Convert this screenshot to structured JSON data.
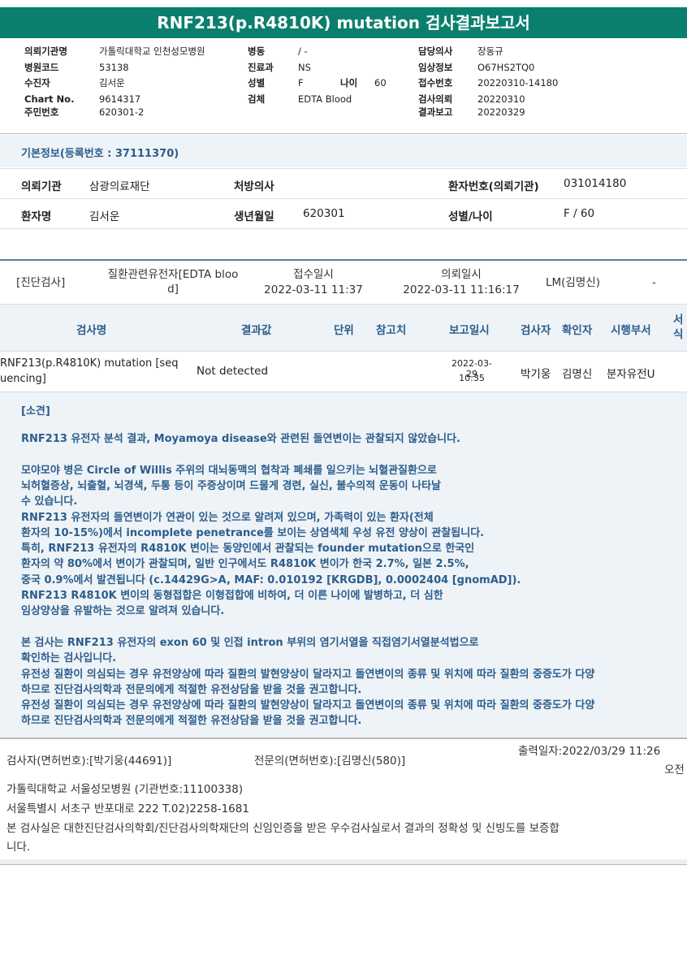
{
  "title": "RNF213(p.R4810K) mutation 검사결과보고서",
  "header": {
    "col1": [
      {
        "label": "의뢰기관명",
        "value": "가톨릭대학교 인천성모병원"
      },
      {
        "label": "병원코드",
        "value": "53138"
      },
      {
        "label": "수진자",
        "value": "김서운"
      },
      {
        "label": "Chart No.",
        "value": "9614317"
      },
      {
        "label": "주민번호",
        "value": "620301-2"
      }
    ],
    "col2": [
      {
        "label": "병동",
        "value": "/ -"
      },
      {
        "label": "진료과",
        "value": "NS"
      },
      {
        "label": "성별",
        "value": "F"
      },
      {
        "label": "검체",
        "value": "EDTA Blood"
      }
    ],
    "age_label": "나이",
    "age_value": "60",
    "col3": [
      {
        "label": "담당의사",
        "value": "장동규"
      },
      {
        "label": "임상정보",
        "value": "O67HS2TQ0"
      },
      {
        "label": "접수번호",
        "value": "20220310-14180"
      },
      {
        "label": "검사의뢰",
        "value": "20220310"
      },
      {
        "label": "결과보고",
        "value": "20220329"
      }
    ]
  },
  "basic": {
    "title": "기본정보(등록번호 : 37111370)",
    "req_org_label": "의뢰기관",
    "req_org": "삼광의료재단",
    "doctor_label": "처방의사",
    "patient_no_label": "환자번호(의뢰기관)",
    "patient_no": "031014180",
    "name_label": "환자명",
    "name": "김서운",
    "dob_label": "생년월일",
    "dob": "620301",
    "sex_age_label": "성별/나이",
    "sex_age": "F / 60"
  },
  "diag": {
    "type": "[진단검사]",
    "specimen_line1": "질환관련유전자[EDTA bloo",
    "specimen_line2": "d]",
    "received_label": "접수일시",
    "received": "2022-03-11 11:37",
    "requested_label": "의뢰일시",
    "requested": "2022-03-11 11:16:17",
    "lm": "LM(김명신)",
    "dash": "-"
  },
  "table": {
    "headers": [
      "검사명",
      "결과값",
      "단위",
      "참고치",
      "보고일시",
      "검사자",
      "확인자",
      "시행부서",
      "서식"
    ],
    "row": {
      "name_line1": "RNF213(p.R4810K) mutation [seq",
      "name_line2": "uencing]",
      "result": "Not detected",
      "date": "2022-03-29",
      "time": "10:35",
      "tester": "박기웅",
      "confirmer": "김명신",
      "dept": "분자유전U"
    }
  },
  "opinion": {
    "title": "[소견]",
    "lines": [
      "RNF213 유전자 분석 결과, Moyamoya disease와 관련된 돌연변이는 관찰되지 않았습니다.",
      "",
      "모야모야 병은 Circle of Willis 주위의 대뇌동맥의 협착과 폐쇄를 일으키는 뇌혈관질환으로",
      "뇌허혈증상, 뇌출혈, 뇌경색, 두통 등이 주증상이며 드물게 경련, 실신, 불수의적 운동이 나타날",
      "수 있습니다.",
      "RNF213 유전자의 돌연변이가 연관이 있는 것으로 알려져 있으며, 가족력이 있는 환자(전체",
      "환자의 10-15%)에서 incomplete penetrance를 보이는 상염색체 우성 유전 양상이 관찰됩니다.",
      "특히, RNF213 유전자의 R4810K 변이는 동양인에서 관찰되는 founder mutation으로 한국인",
      "환자의 약 80%에서 변이가 관찰되며, 일반 인구에서도 R4810K 변이가 한국 2.7%, 일본 2.5%,",
      "중국 0.9%에서 발견됩니다 (c.14429G>A, MAF: 0.010192 [KRGDB], 0.0002404 [gnomAD]).",
      "RNF213 R4810K 변이의 동형접합은 이형접합에 비하여, 더 이른 나이에 발병하고, 더 심한",
      "임상양상을 유발하는 것으로 알려져 있습니다.",
      "",
      "본 검사는 RNF213 유전자의 exon 60 및 인접 intron 부위의 염기서열을 직접염기서열분석법으로",
      "확인하는 검사입니다.",
      "유전성 질환이 의심되는 경우 유전양상에 따라 질환의 발현양상이 달라지고 돌연변이의 종류 및 위치에 따라 질환의 중증도가 다양",
      "하므로 진단검사의학과 전문의에게 적절한 유전상담을 받을 것을 권고합니다.",
      "유전성 질환이 의심되는 경우 유전양상에 따라 질환의 발현양상이 달라지고 돌연변이의 종류 및 위치에 따라 질환의 중증도가 다양",
      "하므로 진단검사의학과 전문의에게 적절한 유전상담을 받을 것을 권고합니다."
    ]
  },
  "footer": {
    "tester": "검사자(면허번호):[박기웅(44691)]",
    "specialist": "전문의(면허번호):[김명신(580)]",
    "printed": "출력일자:2022/03/29 11:26",
    "ampm": "오전",
    "hospital": "가톨릭대학교 서울성모병원 (기관번호:11100338)",
    "address": "서울특별시 서초구 반포대로 222 T.02)2258-1681",
    "cert_line1": "본 검사실은 대한진단검사의학회/진단검사의학재단의 신임인증을 받은 우수검사실로서 결과의 정확성 및 신빙도를 보증합",
    "cert_line2": "니다."
  }
}
